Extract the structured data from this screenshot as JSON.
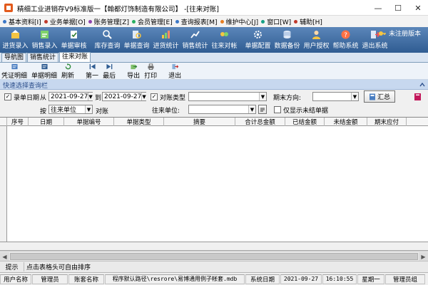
{
  "window": {
    "title": "精细工业进销存V9标准版一【翰都灯饰制造有限公司】 -[往来对账]",
    "minimize": "—",
    "maximize": "☐",
    "close": "✕"
  },
  "menu": [
    {
      "label": "基本资料[I]",
      "color": "#3b77c6"
    },
    {
      "label": "业务单据[O]",
      "color": "#c0392b"
    },
    {
      "label": "账务管理[Z]",
      "color": "#8e44ad"
    },
    {
      "label": "会员管理[E]",
      "color": "#27ae60"
    },
    {
      "label": "查询报表[M]",
      "color": "#3b77c6"
    },
    {
      "label": "维护中心[J]",
      "color": "#e67e22"
    },
    {
      "label": "窗口[W]",
      "color": "#16a085"
    },
    {
      "label": "辅助[H]",
      "color": "#c0392b"
    }
  ],
  "toolbar": [
    {
      "label": "进货录入",
      "icon": "stock-in-icon"
    },
    {
      "label": "销售录入",
      "icon": "sales-entry-icon"
    },
    {
      "label": "单据审核",
      "icon": "audit-icon"
    },
    {
      "label": "库存查询",
      "icon": "inventory-query-icon"
    },
    {
      "label": "单据查询",
      "icon": "document-query-icon"
    },
    {
      "label": "进货统计",
      "icon": "purchase-stats-icon"
    },
    {
      "label": "销售统计",
      "icon": "sales-stats-icon"
    },
    {
      "label": "往来对帐",
      "icon": "reconcile-icon"
    },
    {
      "label": "单据配置",
      "icon": "doc-config-icon"
    },
    {
      "label": "数据备份",
      "icon": "backup-icon"
    },
    {
      "label": "用户授权",
      "icon": "user-auth-icon"
    },
    {
      "label": "帮助系统",
      "icon": "help-icon"
    },
    {
      "label": "退出系统",
      "icon": "exit-icon"
    }
  ],
  "unregistered": "未注册版本",
  "tabs": [
    {
      "label": "导航图",
      "active": false
    },
    {
      "label": "销售统计",
      "active": false
    },
    {
      "label": "往来对账",
      "active": true
    }
  ],
  "toolbar2": [
    {
      "label": "凭证明细",
      "icon": "voucher-detail-icon"
    },
    {
      "label": "单据明细",
      "icon": "doc-detail-icon"
    },
    {
      "label": "刷新",
      "icon": "refresh-icon"
    },
    {
      "label": "第一",
      "icon": "first-icon"
    },
    {
      "label": "最后",
      "icon": "last-icon"
    },
    {
      "label": "导出",
      "icon": "export-icon"
    },
    {
      "label": "打印",
      "icon": "print-icon"
    },
    {
      "label": "退出",
      "icon": "exit-icon"
    }
  ],
  "quick_bar": "快速选择查询栏",
  "filters": {
    "date_checkbox_label": "录单日期",
    "from_label": "从",
    "from_date": "2021-09-27",
    "to_label": "到",
    "to_date": "2021-09-27",
    "type_checkbox_label": "对账类型",
    "type_value": "",
    "period_direction_label": "期末方向:",
    "period_direction_value": "",
    "summary_button": "汇总",
    "by_label": "按",
    "by_value": "往来单位",
    "reconcile_label": "对账",
    "partner_label": "往来单位:",
    "partner_value": "",
    "only_unsettled_label": "仅显示未结单据"
  },
  "grid": {
    "columns": [
      "序号",
      "日期",
      "单据编号",
      "单据类型",
      "摘要",
      "合计总金额",
      "已结金额",
      "未结金额",
      "期末应付"
    ],
    "rows": []
  },
  "hint": {
    "key": "提示",
    "value": "点击表格头可自由排序"
  },
  "status": [
    {
      "label": "用户名称"
    },
    {
      "label": "管理员"
    },
    {
      "label": "账套名称"
    },
    {
      "label": "程序默认路径\\resrore\\易博通用例子帐套.mdb"
    },
    {
      "label": "系统日期"
    },
    {
      "label": "2021-09-27"
    },
    {
      "label": "16:10:55"
    },
    {
      "label": "星期一"
    },
    {
      "label": "管理员组"
    }
  ]
}
